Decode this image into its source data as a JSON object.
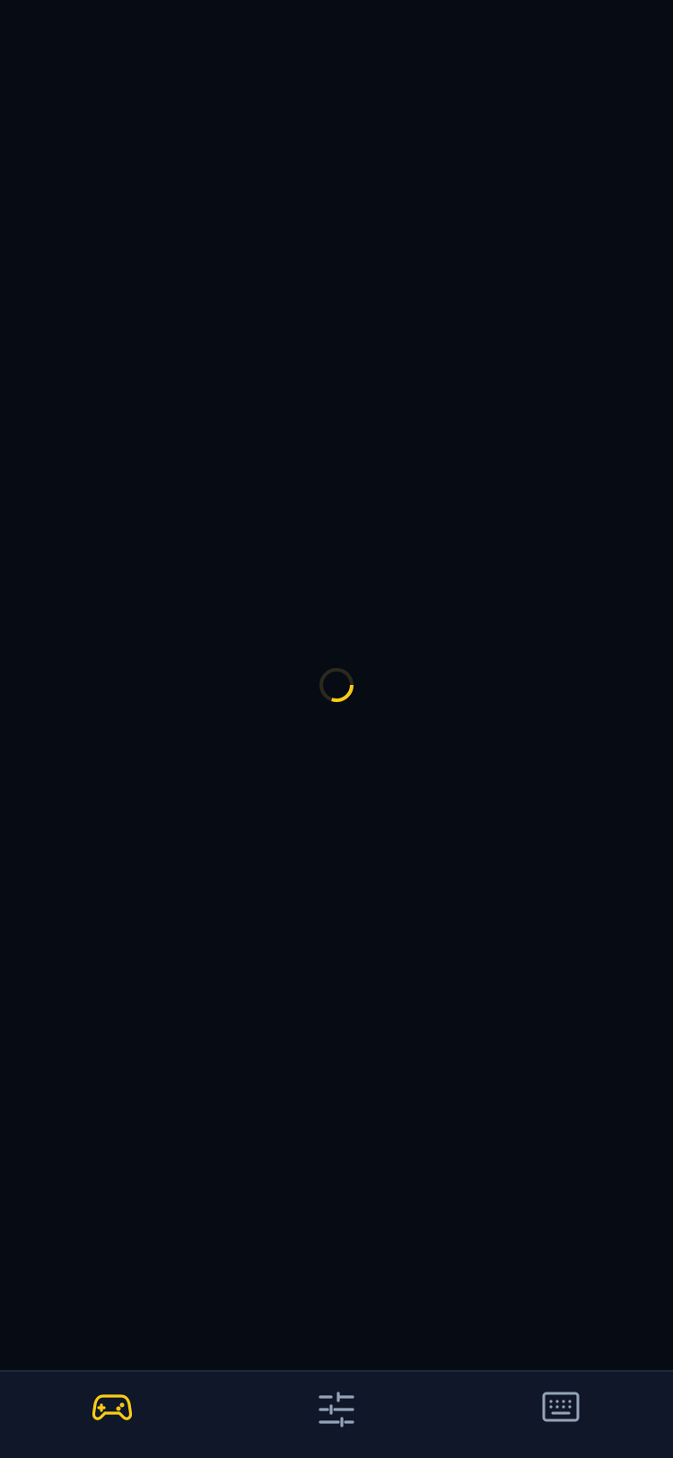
{
  "loading": {
    "progress": 0.3,
    "track_color": "#2b2a1e",
    "accent_color": "#facc15"
  },
  "tabs": [
    {
      "id": "games",
      "icon": "gamepad-icon",
      "active": true,
      "color": "#facc15"
    },
    {
      "id": "settings",
      "icon": "sliders-icon",
      "active": false,
      "color": "#94a3b8"
    },
    {
      "id": "keyboard",
      "icon": "keyboard-icon",
      "active": false,
      "color": "#94a3b8"
    }
  ]
}
